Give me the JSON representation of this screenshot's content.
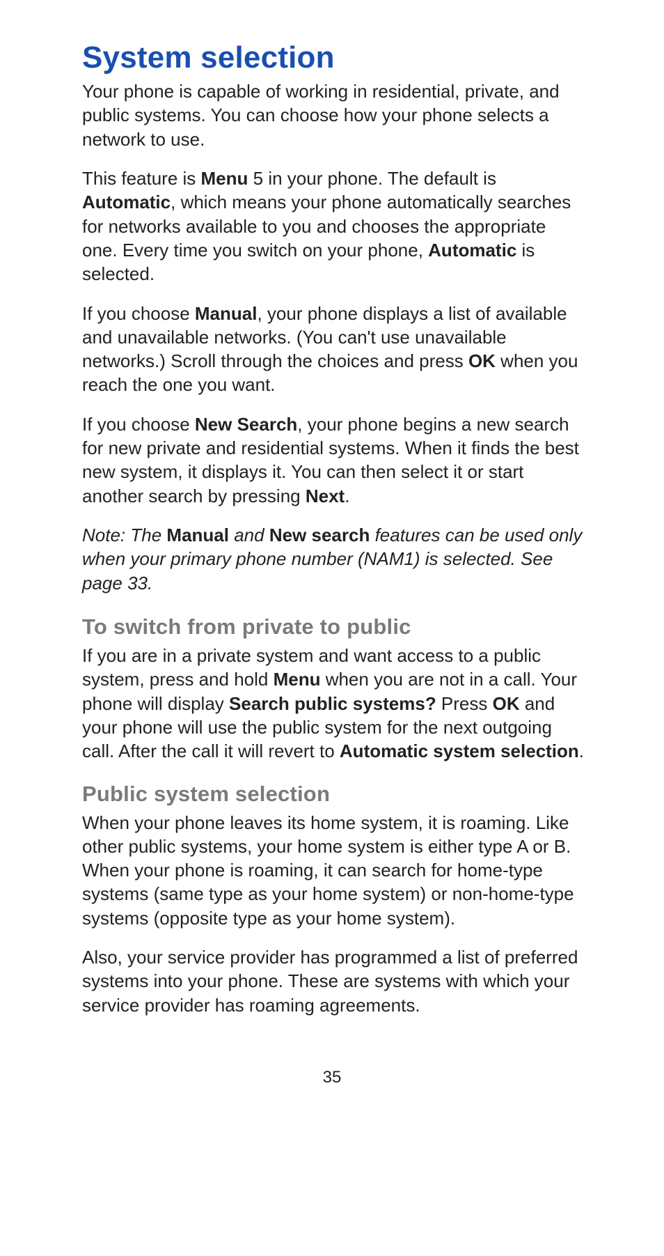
{
  "title": "System selection",
  "p1_a": "Your phone is capable of working in residential, private, and public systems. You can choose how your phone selects a network to use.",
  "p2_a": "This feature is ",
  "p2_b1": "Menu",
  "p2_c": " 5 in your phone. The default is ",
  "p2_b2": "Automatic",
  "p2_d": ", which means your phone automatically searches for networks available to you and chooses the appropriate one. Every time you switch on your phone, ",
  "p2_b3": "Automatic",
  "p2_e": " is selected.",
  "p3_a": "If you choose ",
  "p3_b1": "Manual",
  "p3_c": ", your phone displays a list of available and unavailable networks. (You can't use unavailable networks.) Scroll through the choices and press ",
  "p3_b2": "OK",
  "p3_d": " when you reach the one you want.",
  "p4_a": "If you choose ",
  "p4_b1": "New Search",
  "p4_c": ", your phone begins a new search for new private and residential systems. When it finds the best new system, it displays it. You can then select it or start another search by pressing ",
  "p4_b2": "Next",
  "p4_d": ".",
  "note_a": "Note:  The ",
  "note_b1": "Manual",
  "note_b": " and ",
  "note_b2": "New search",
  "note_c": " features can be used only when your primary phone number (NAM1) is selected. See page 33.",
  "sub1": "To switch from private to public",
  "p5_a": "If you are in a private system and want access to a public system, press and hold ",
  "p5_b1": "Menu",
  "p5_b": " when you are not in a call. Your phone will display ",
  "p5_b2": "Search public systems?",
  "p5_c": " Press ",
  "p5_b3": "OK",
  "p5_d": " and your phone will use the public system for the next outgoing call. After the call it will revert to ",
  "p5_b4": "Automatic system selection",
  "p5_e": ".",
  "sub2": "Public system selection",
  "p6_a": "When your phone leaves its home system, it is roaming. Like other public systems, your home system is either type A or B. When your phone is roaming, it can search for home-type systems (same type as your home system) or non-home-type systems (opposite type as your home system).",
  "p7_a": "Also, your service provider has programmed a list of preferred systems into your phone. These are systems with which your service provider has roaming agreements.",
  "pagenum": "35"
}
